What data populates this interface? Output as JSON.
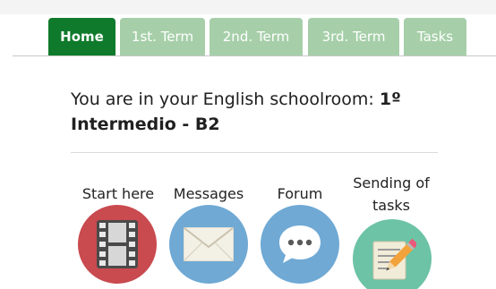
{
  "tabs": [
    {
      "label": "Home",
      "active": true
    },
    {
      "label": "1st. Term",
      "active": false
    },
    {
      "label": "2nd. Term",
      "active": false
    },
    {
      "label": "3rd. Term",
      "active": false
    },
    {
      "label": "Tasks",
      "active": false
    }
  ],
  "heading": {
    "prefix": "You are in your English schoolroom: ",
    "course": "1º Intermedio - B2"
  },
  "shortcuts": [
    {
      "label": "Start here",
      "icon": "film-strip-icon",
      "color": "#c94a4f"
    },
    {
      "label": "Messages",
      "icon": "envelope-icon",
      "color": "#6fa9d4"
    },
    {
      "label": "Forum",
      "icon": "speech-bubble-icon",
      "color": "#6fa9d4"
    },
    {
      "label_line1": "Sending of",
      "label_line2": "tasks",
      "icon": "pencil-notepad-icon",
      "color": "#6cc3a6"
    }
  ],
  "colors": {
    "tab_active": "#0f7a2b",
    "tab_inactive": "#a6cfa9"
  }
}
